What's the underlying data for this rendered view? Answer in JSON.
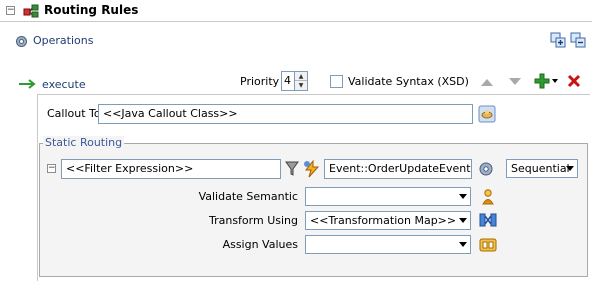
{
  "header": {
    "title": "Routing Rules",
    "collapse_glyph": "−"
  },
  "operations": {
    "label": "Operations"
  },
  "toolbar_top": {
    "icons": [
      "expand-all-icon",
      "collapse-all-icon"
    ]
  },
  "rule": {
    "label": "execute",
    "priority_label": "Priority",
    "priority_value": "4",
    "validate_syntax_label": "Validate Syntax (XSD)",
    "validate_syntax_checked": false
  },
  "callout": {
    "label": "Callout To",
    "value": "<<Java Callout Class>>"
  },
  "static_routing": {
    "legend": "Static Routing",
    "filter_expression": "<<Filter Expression>>",
    "event": "Event::OrderUpdateEvent",
    "mode": "Sequential",
    "collapse_glyph": "−",
    "validate_semantic": {
      "label": "Validate Semantic",
      "value": ""
    },
    "transform_using": {
      "label": "Transform Using",
      "value": "<<Transformation Map>>"
    },
    "assign_values": {
      "label": "Assign Values",
      "value": ""
    }
  },
  "colors": {
    "accent_red": "#cc1111",
    "accent_green": "#2f9a2f",
    "link": "#1f3d73",
    "legend": "#3b5998"
  }
}
